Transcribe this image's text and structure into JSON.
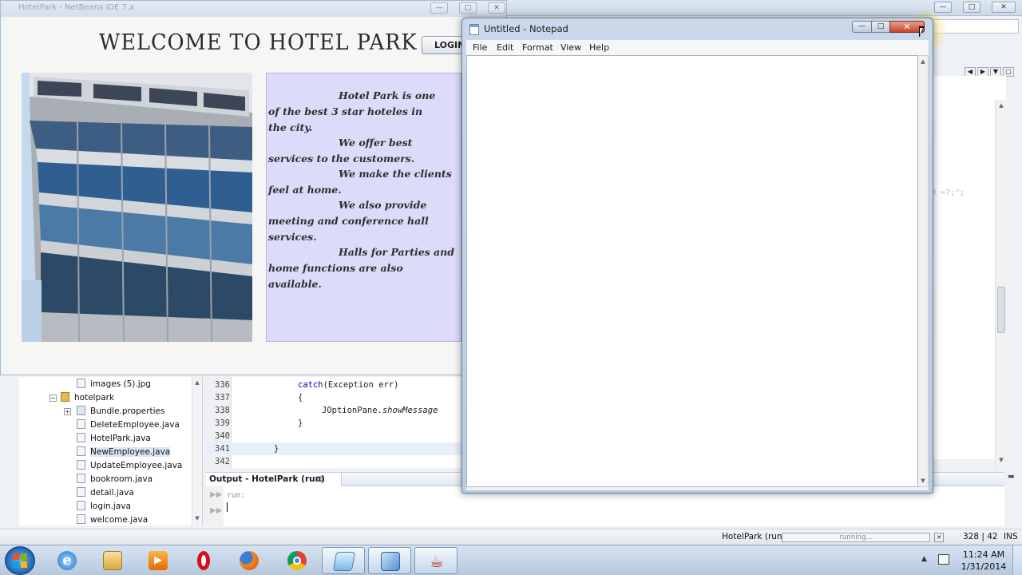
{
  "hotel_app": {
    "title": "HotelPark - NetBeans IDE 7.x",
    "heading": "WELCOME TO HOTEL PARK",
    "login_label": "LOGIN",
    "info_lines": [
      "Hotel Park is one",
      "of the best 3 star hoteles in",
      "the city.",
      "We offer best",
      "services to the customers.",
      "We make the clients",
      "feel at home.",
      "We also provide",
      "meeting and conference hall",
      "services.",
      "Halls for Parties and",
      "home functions are also",
      "available."
    ]
  },
  "notepad": {
    "title": "Untitled - Notepad",
    "menu": [
      "File",
      "Edit",
      "Format",
      "View",
      "Help"
    ],
    "minimize": "—",
    "maximize": "□",
    "close": "✕",
    "content": ""
  },
  "ide": {
    "code_fragment": "ID =?;\";",
    "project_tree": [
      {
        "label": "images (5).jpg",
        "type": "file"
      },
      {
        "label": "hotelpark",
        "type": "package"
      },
      {
        "label": "Bundle.properties",
        "type": "properties"
      },
      {
        "label": "DeleteEmployee.java",
        "type": "java"
      },
      {
        "label": "HotelPark.java",
        "type": "java"
      },
      {
        "label": "NewEmployee.java",
        "type": "java"
      },
      {
        "label": "UpdateEmployee.java",
        "type": "java"
      },
      {
        "label": "bookroom.java",
        "type": "java"
      },
      {
        "label": "detail.java",
        "type": "java"
      },
      {
        "label": "login.java",
        "type": "java"
      },
      {
        "label": "welcome.java",
        "type": "java"
      }
    ],
    "code_lines": [
      {
        "no": "336",
        "kw": "catch",
        "rest": "(Exception err)"
      },
      {
        "no": "337",
        "text": "{"
      },
      {
        "no": "338",
        "text": "JOptionPane.",
        "italic": "showMessage"
      },
      {
        "no": "339",
        "text": "}"
      },
      {
        "no": "340",
        "text": ""
      },
      {
        "no": "341",
        "text": "}"
      },
      {
        "no": "342",
        "text": ""
      }
    ],
    "output_tab": "Output - HotelPark (run)",
    "output_close": "⊠",
    "output_text": "run:",
    "status_project": "HotelPark (run)",
    "status_progress_text": "running...",
    "status_progress": 0.0,
    "status_position": "328 | 42",
    "status_mode": "INS"
  },
  "taskbar": {
    "apps": [
      {
        "name": "internet-explorer",
        "active": false
      },
      {
        "name": "file-explorer",
        "active": false
      },
      {
        "name": "media-player",
        "active": false
      },
      {
        "name": "opera",
        "active": false
      },
      {
        "name": "firefox",
        "active": false
      },
      {
        "name": "chrome",
        "active": false
      },
      {
        "name": "notepad",
        "active": true
      },
      {
        "name": "netbeans",
        "active": true
      },
      {
        "name": "java",
        "active": true
      }
    ],
    "time": "11:24 AM",
    "date": "1/31/2014"
  }
}
